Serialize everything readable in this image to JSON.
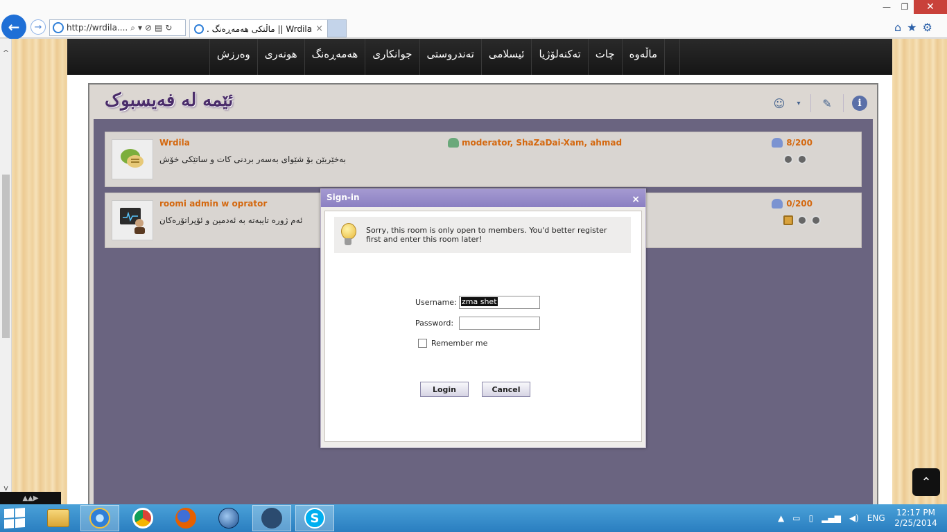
{
  "browser": {
    "address_url": "http://wrdila....",
    "tab_title": "Wrdila || ماڵتکی هەمەڕەنگ ...",
    "back_glyph": "←",
    "forward_glyph": "→",
    "tab_close_glyph": "×",
    "minimize_glyph": "—",
    "maximize_glyph": "❐",
    "close_glyph": "✕",
    "home_glyph": "⌂",
    "favorites_glyph": "★",
    "settings_glyph": "⚙",
    "search_glyph": "⌕",
    "dropdown_glyph": "▾",
    "stop_glyph": "⊘",
    "compat_glyph": "▤",
    "refresh_glyph": "↻"
  },
  "site": {
    "menu": [
      "ماڵەوە",
      "چات",
      "تەکنەلۆژیا",
      "ئیسلامی",
      "تەندروستی",
      "جوانکاری",
      "هەمەڕەنگ",
      "هونەری",
      "وەرزش"
    ],
    "brand_title": "ئێمە لە فەیسبوک",
    "header_icons": {
      "user": "☺",
      "dropdown": "▾",
      "tools": "✎",
      "info": "i"
    }
  },
  "rooms": [
    {
      "name": "Wrdila",
      "description": "بەخێربێن بۆ شێوای بەسەر بردنی کات و ساتێکی خۆش",
      "moderators": "moderator, ShaZaDai-Xam, ahmad",
      "count": "8/200"
    },
    {
      "name": "roomi admin w oprator",
      "description": "ئەم ژورە تایبەتە بە ئەدمین و ئۆپراتۆرەکان",
      "moderators": "",
      "count": "0/200"
    }
  ],
  "signin": {
    "title": "Sign-in",
    "close_glyph": "×",
    "notice": "Sorry, this room is only open to members. You'd better register first and enter this room later!",
    "username_label": "Username:",
    "username_value": "zma shet",
    "password_label": "Password:",
    "password_value": "",
    "remember_label": "Remember me",
    "login_label": "Login",
    "cancel_label": "Cancel"
  },
  "page_extras": {
    "to_top_glyph": "⌃",
    "mini_glyph": "▲▲▶"
  },
  "taskbar": {
    "tray_language": "ENG",
    "time": "12:17 PM",
    "date": "2/25/2014",
    "tray_arrow": "▲",
    "skype_letter": "S"
  },
  "colors": {
    "accent_orange": "#d4680f",
    "dialog_title": "#8b7fc2",
    "room_area": "#6a6480",
    "taskbar": "#2a7ec0"
  }
}
